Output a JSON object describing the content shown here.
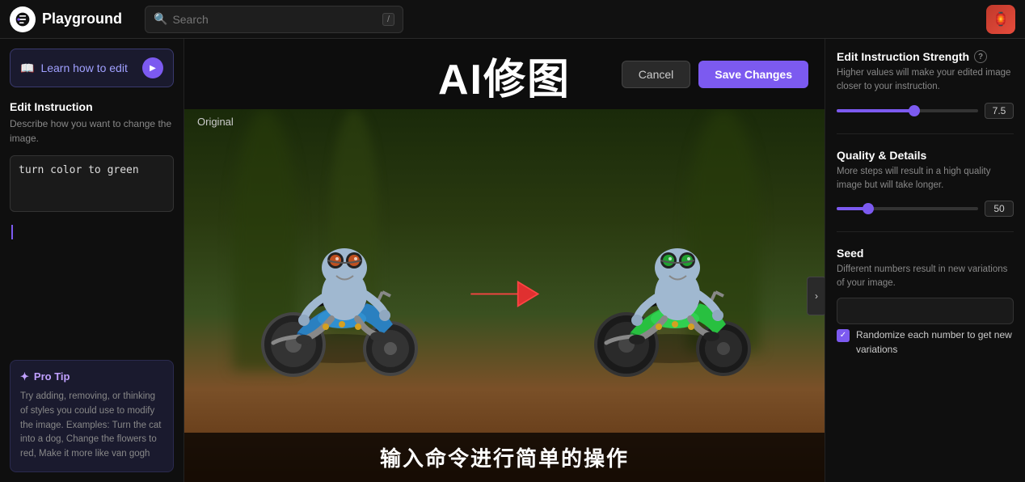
{
  "topnav": {
    "logo_label": "Playground",
    "search_placeholder": "Search",
    "search_shortcut": "/",
    "avatar_emoji": "🏮"
  },
  "sidebar": {
    "learn_btn_label": "Learn how to edit",
    "play_icon": "▶",
    "edit_instruction_title": "Edit Instruction",
    "edit_instruction_desc": "Describe how you want to change the image.",
    "edit_instruction_value": "turn color to green",
    "pro_tip_title": "Pro Tip",
    "pro_tip_icon": "✦",
    "pro_tip_text": "Try adding, removing, or thinking of styles you could use to modify the image. Examples: Turn the cat into a dog, Change the flowers to red, Make it more like van gogh"
  },
  "center": {
    "title": "AI修图",
    "cancel_label": "Cancel",
    "save_label": "Save Changes",
    "original_label": "Original",
    "subtitle": "输入命令进行简单的操作"
  },
  "right_panel": {
    "strength_title": "Edit Instruction Strength",
    "strength_info": "?",
    "strength_desc": "Higher values will make your edited image closer to your instruction.",
    "strength_value": "7.5",
    "strength_percent": 55,
    "quality_title": "Quality & Details",
    "quality_desc": "More steps will result in a high quality image but will take longer.",
    "quality_value": "50",
    "quality_percent": 22,
    "seed_title": "Seed",
    "seed_desc": "Different numbers result in new variations of your image.",
    "seed_placeholder": "",
    "randomize_label": "Randomize each number to get new variations"
  }
}
